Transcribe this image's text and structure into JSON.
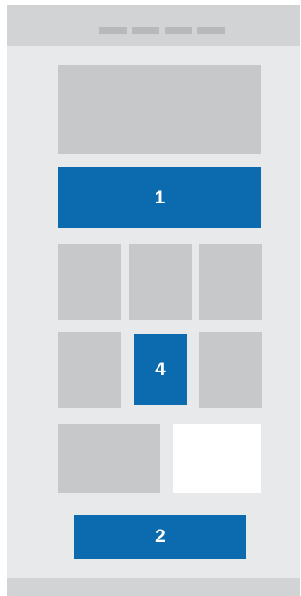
{
  "labels": {
    "one": "1",
    "four": "4",
    "two": "2"
  },
  "colors": {
    "accent": "#0c6aae",
    "placeholder": "#c7c8c9",
    "background": "#e8e9ea",
    "bar": "#d2d3d4"
  }
}
